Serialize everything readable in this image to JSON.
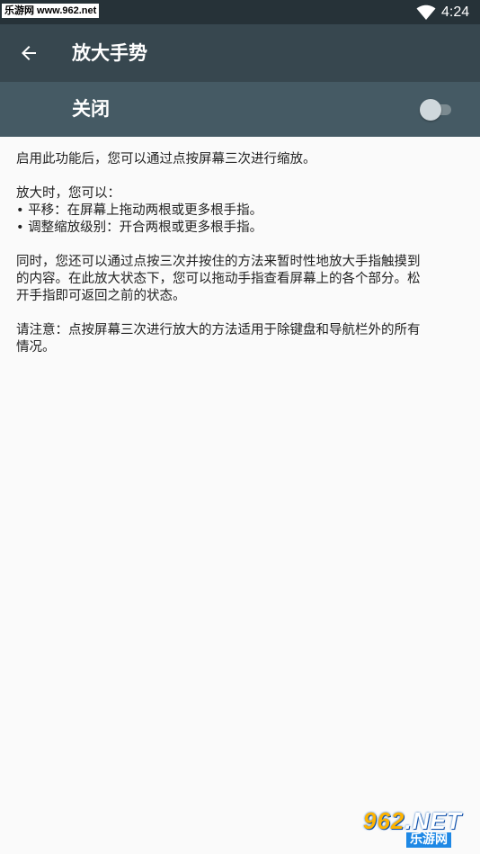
{
  "status_bar": {
    "source_label": "乐游网 www.962.net",
    "time": "4:24"
  },
  "toolbar": {
    "title": "放大手势",
    "back_icon": "arrow-back-icon"
  },
  "switch_bar": {
    "label": "关闭",
    "toggle_on": false
  },
  "content": {
    "intro": "启用此功能后，您可以通过点按屏幕三次进行缩放。",
    "when_zoomed": "放大时，您可以：",
    "bullets": [
      "• 平移：在屏幕上拖动两根或更多根手指。",
      "• 调整缩放级别：开合两根或更多根手指。"
    ],
    "temp_line1": "同时，您还可以通过点按三次并按住的方法来暂时性地放大手指触摸到",
    "temp_line2": "的内容。在此放大状态下，您可以拖动手指查看屏幕上的各个部分。松",
    "temp_line3": "开手指即可返回之前的状态。",
    "note_line1": "请注意：点按屏幕三次进行放大的方法适用于除键盘和导航栏外的所有",
    "note_line2": "情况。"
  },
  "watermark": {
    "main_pre": "962",
    "main_post": ".NET",
    "sub": "乐游网"
  },
  "colors": {
    "status_bar": "#263238",
    "toolbar": "#37474f",
    "switch_bar": "#455a64",
    "background": "#fafafa"
  }
}
